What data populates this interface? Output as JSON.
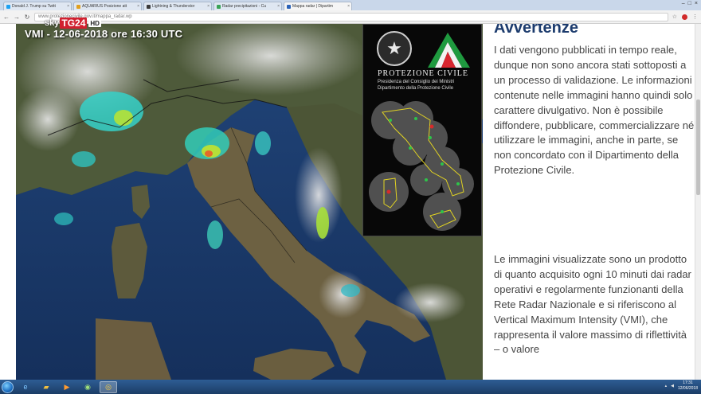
{
  "browser": {
    "tabs": [
      {
        "label": "Donald J. Trump su Twitt",
        "color": "#1da1f2"
      },
      {
        "label": "AQUARIUS Posizione att",
        "color": "#e0a020"
      },
      {
        "label": "Lightning & Thunderstor",
        "color": "#3a3a3a"
      },
      {
        "label": "Radar precipitazioni - Cu",
        "color": "#3aa357"
      },
      {
        "label": "Mappa radar | Dipartim",
        "color": "#2a62b8"
      }
    ],
    "address": "www.protezionecivile.gov.it/mappa_radar.wp"
  },
  "map": {
    "timestamp": "VMI - 12-06-2018 ore 16:30 UTC"
  },
  "panel": {
    "title": "PROTEZIONE CIVILE",
    "subtitle1": "Presidenza del Consiglio dei Ministri",
    "subtitle2": "Dipartimento della Protezione Civile"
  },
  "article": {
    "heading": "Avvertenze",
    "paragraph1": "I dati vengono pubblicati in tempo reale, dunque non sono ancora stati sottoposti a un processo di validazione. Le informazioni contenute nelle immagini hanno quindi solo carattere divulgativo. Non è possibile diffondere, pubblicare, commercializzare né utilizzare le immagini, anche in parte, se non concordato con il Dipartimento della Protezione Civile.",
    "paragraph2": "Le immagini visualizzate sono un prodotto di quanto acquisito ogni 10 minuti dai radar operativi e regolarmente funzionanti della Rete Radar Nazionale e si riferiscono al Vertical Maximum Intensity (VMI), che rappresenta il valore massimo di riflettività – o valore"
  },
  "watermark": {
    "sky": "sky",
    "tg24": "TG24",
    "hd": "HD"
  },
  "taskbar": {
    "time": "17:31",
    "date": "12/06/2018"
  }
}
